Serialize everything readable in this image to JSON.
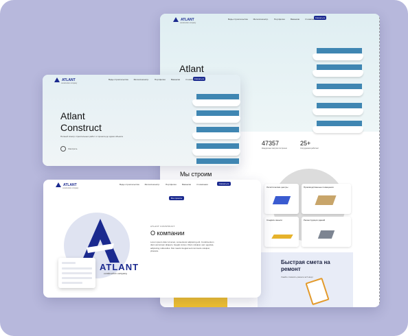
{
  "logo": {
    "name": "ATLANT",
    "tagline": "construction company"
  },
  "nav": [
    "Виды строительства",
    "Металлоконстр.",
    "Портфолио",
    "Вакансии",
    "О компании"
  ],
  "nav_button": "Связаться",
  "back_page": {
    "hero_title": "Atlant",
    "stats": [
      {
        "number": "47357",
        "label": "Квадратных метров построено"
      },
      {
        "number": "25+",
        "label": "Сотрудников работает"
      }
    ],
    "services": [
      {
        "label": "Логистические центры"
      },
      {
        "label": "Производственные помещения"
      },
      {
        "label": "Сэндвич-панели"
      },
      {
        "label": "Реконструкция зданий"
      }
    ],
    "estimate": {
      "title": "Быстрая смета на ремонт",
      "subtitle": "Узнайте стоимость ремонта за 5 минут"
    }
  },
  "front_page": {
    "title": "Atlant Construct",
    "description": "Полный спектр строительных работ от проекта до сдачи объекта",
    "play_label": "Смотреть"
  },
  "we_build": "Мы строим",
  "about_page": {
    "all_projects": "Все проекты",
    "brand": "ATLANT",
    "brand_sub": "construction company",
    "kicker": "ATLANT CONSTRUCT",
    "heading": "О компании",
    "paragraph": "Lorem ipsum dolor sit amet, consectetur adipiscing elit. Condimentum diam accumsan aliquam, feugiat cursus. Diam volutpat, sem egestas, adipiscing nulla tellus. Nisi mauris feugiat sed commodo volutpat, pharetra."
  },
  "colors": {
    "brand": "#1b2a8f",
    "accent": "#f2c230",
    "frame": "#b7b8dc"
  }
}
